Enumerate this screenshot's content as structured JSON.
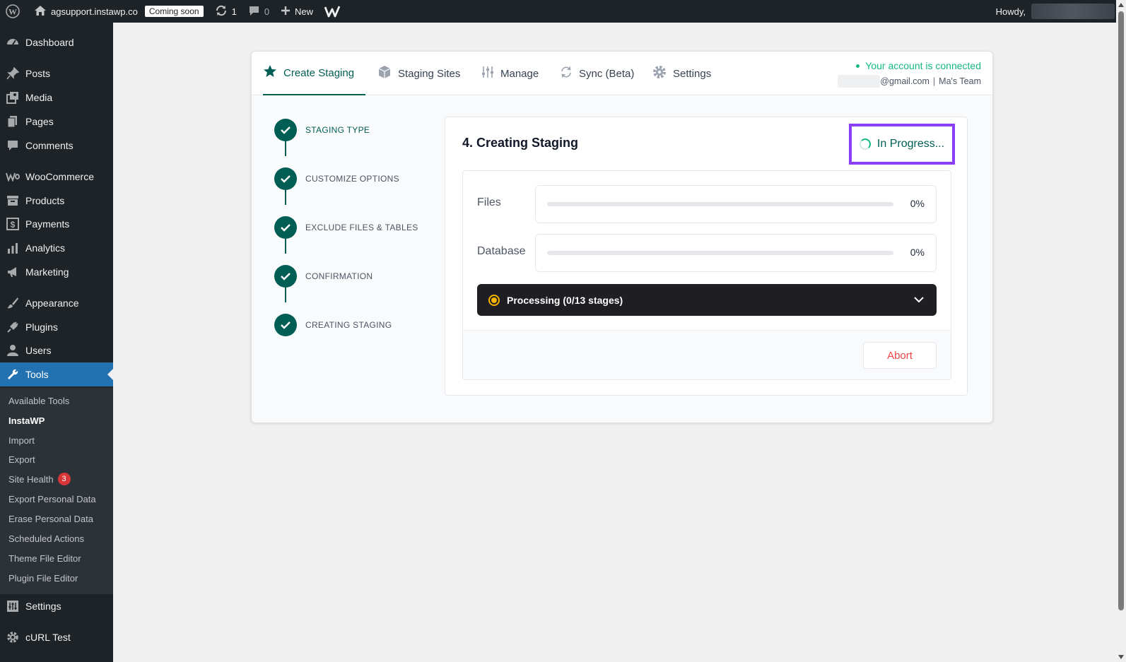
{
  "admin_bar": {
    "site_name": "agsupport.instawp.co",
    "coming_soon": "Coming soon",
    "updates_count": "1",
    "comments_count": "0",
    "new_label": "New",
    "howdy": "Howdy,"
  },
  "sidebar": {
    "items": [
      {
        "label": "Dashboard",
        "icon": "dashboard-icon"
      },
      {
        "label": "Posts",
        "icon": "pin-icon"
      },
      {
        "label": "Media",
        "icon": "media-icon"
      },
      {
        "label": "Pages",
        "icon": "page-icon"
      },
      {
        "label": "Comments",
        "icon": "comment-icon"
      },
      {
        "label": "WooCommerce",
        "icon": "woo-icon"
      },
      {
        "label": "Products",
        "icon": "archive-icon"
      },
      {
        "label": "Payments",
        "icon": "dollar-icon"
      },
      {
        "label": "Analytics",
        "icon": "bar-chart-icon"
      },
      {
        "label": "Marketing",
        "icon": "megaphone-icon"
      },
      {
        "label": "Appearance",
        "icon": "brush-icon"
      },
      {
        "label": "Plugins",
        "icon": "plug-icon"
      },
      {
        "label": "Users",
        "icon": "user-icon"
      },
      {
        "label": "Tools",
        "icon": "wrench-icon"
      },
      {
        "label": "Settings",
        "icon": "sliders-icon"
      },
      {
        "label": "cURL Test",
        "icon": "gear-icon"
      }
    ],
    "tools_submenu": [
      {
        "label": "Available Tools"
      },
      {
        "label": "InstaWP"
      },
      {
        "label": "Import"
      },
      {
        "label": "Export"
      },
      {
        "label": "Site Health",
        "badge": "3"
      },
      {
        "label": "Export Personal Data"
      },
      {
        "label": "Erase Personal Data"
      },
      {
        "label": "Scheduled Actions"
      },
      {
        "label": "Theme File Editor"
      },
      {
        "label": "Plugin File Editor"
      }
    ]
  },
  "tabs": [
    {
      "label": "Create Staging",
      "icon": "star-icon"
    },
    {
      "label": "Staging Sites",
      "icon": "cube-icon"
    },
    {
      "label": "Manage",
      "icon": "sliders-icon"
    },
    {
      "label": "Sync (Beta)",
      "icon": "sync-icon"
    },
    {
      "label": "Settings",
      "icon": "gear-icon"
    }
  ],
  "account": {
    "status": "Your account is connected",
    "email_suffix": "@gmail.com",
    "team": "Ma's Team"
  },
  "steps": [
    {
      "label": "STAGING TYPE"
    },
    {
      "label": "CUSTOMIZE OPTIONS"
    },
    {
      "label": "EXCLUDE FILES & TABLES"
    },
    {
      "label": "CONFIRMATION"
    },
    {
      "label": "CREATING STAGING"
    }
  ],
  "panel": {
    "title": "4. Creating Staging",
    "status": "In Progress...",
    "progress": [
      {
        "label": "Files",
        "percent_text": "0%",
        "value": 0
      },
      {
        "label": "Database",
        "percent_text": "0%",
        "value": 0
      }
    ],
    "processing": "Processing (0/13 stages)",
    "abort_label": "Abort"
  },
  "colors": {
    "brand": "#005e54",
    "connected": "#15b881",
    "highlight": "#8a3ffc",
    "wp_admin_dark": "#1d2327",
    "wp_active_blue": "#2271b1",
    "abort_red": "#ef4444"
  }
}
